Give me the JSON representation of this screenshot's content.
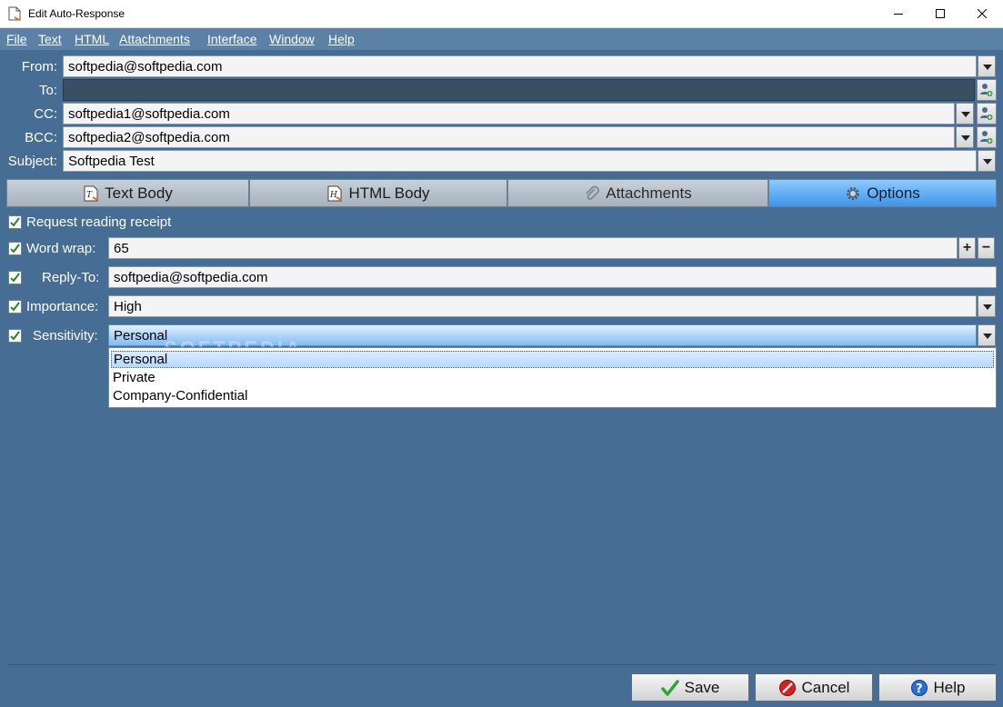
{
  "window": {
    "title": "Edit Auto-Response"
  },
  "menu": {
    "items": [
      "File",
      "Text",
      "HTML",
      "Attachments",
      "Interface",
      "Window",
      "Help"
    ]
  },
  "header_fields": {
    "from": {
      "label": "From:",
      "value": "softpedia@softpedia.com"
    },
    "to": {
      "label": "To:",
      "value": ""
    },
    "cc": {
      "label": "CC:",
      "value": "softpedia1@softpedia.com"
    },
    "bcc": {
      "label": "BCC:",
      "value": "softpedia2@softpedia.com"
    },
    "subject": {
      "label": "Subject:",
      "value": "Softpedia Test"
    }
  },
  "tabs": [
    {
      "label": "Text Body",
      "icon": "text-body-icon"
    },
    {
      "label": "HTML Body",
      "icon": "html-body-icon"
    },
    {
      "label": "Attachments",
      "icon": "paperclip-icon"
    },
    {
      "label": "Options",
      "icon": "gear-icon",
      "active": true
    }
  ],
  "options": {
    "read_receipt": {
      "label": "Request reading receipt",
      "checked": true
    },
    "word_wrap": {
      "label": "Word wrap:",
      "value": "65",
      "checked": true
    },
    "reply_to": {
      "label": "Reply-To:",
      "value": "softpedia@softpedia.com",
      "checked": true
    },
    "importance": {
      "label": "Importance:",
      "value": "High",
      "checked": true
    },
    "sensitivity": {
      "label": "Sensitivity:",
      "value": "Personal",
      "checked": true,
      "options": [
        "Personal",
        "Private",
        "Company-Confidential"
      ]
    }
  },
  "watermark": "SOFTPEDIA",
  "buttons": {
    "save": "Save",
    "cancel": "Cancel",
    "help": "Help"
  },
  "colors": {
    "background": "#466d93",
    "menubar": "#5b81a7",
    "active_tab": "#3e95e8",
    "check": "#1f8a2a"
  }
}
